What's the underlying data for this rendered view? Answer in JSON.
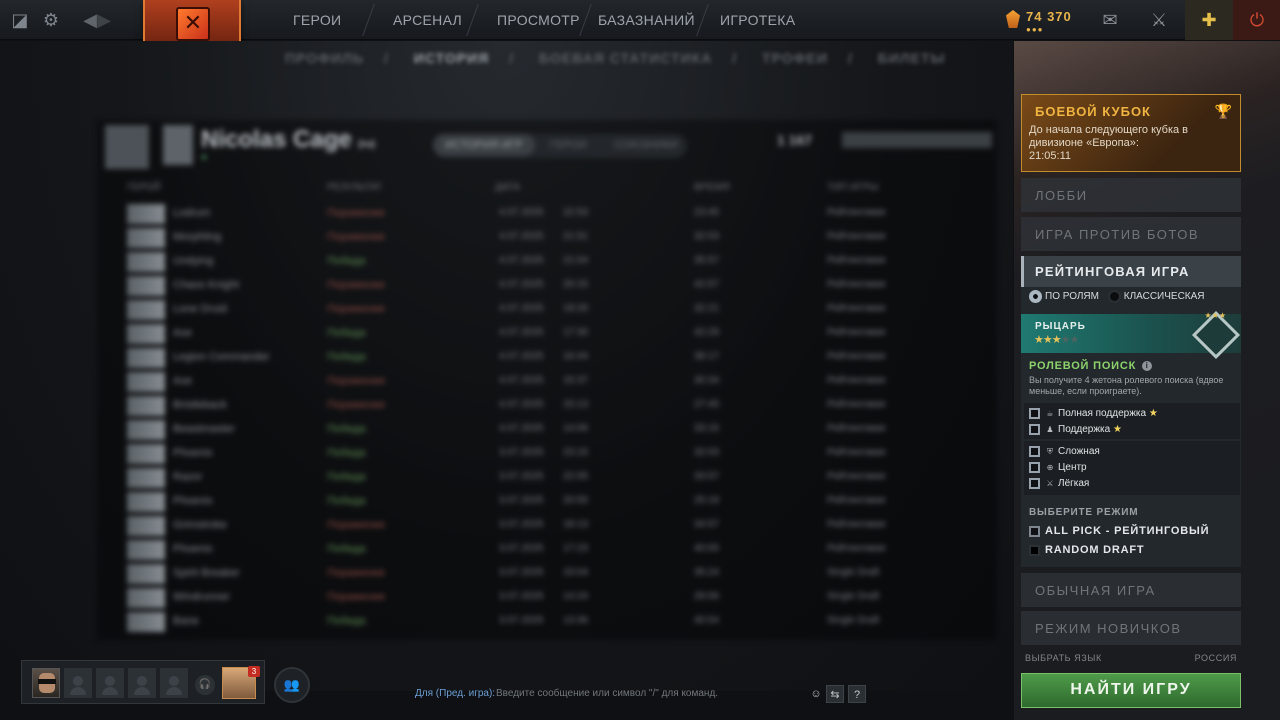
{
  "topbar": {
    "nav": [
      "ГЕРОИ",
      "АРСЕНАЛ",
      "ПРОСМОТР",
      "БАЗАЗНАНИЙ",
      "ИГРОТЕКА"
    ],
    "currency_amount": "74 370",
    "currency_dots": "●●●"
  },
  "subnav": [
    "ПРОФИЛЬ",
    "ИСТОРИЯ",
    "БОЕВАЯ СТАТИСТИКА",
    "ТРОФЕИ",
    "БИЛЕТЫ"
  ],
  "profile": {
    "name": "Nicolas Cage",
    "name_suffix": "(ru)",
    "tabs": [
      "ИСТОРИЯ ИГР",
      "ГЕРОИ",
      "СОЮЗНИКИ"
    ],
    "stat_value": "1 167",
    "columns": [
      "ГЕРОЙ",
      "РЕЗУЛЬТАТ",
      "ДАТА",
      "ВРЕМЯ",
      "ТИП ИГРЫ"
    ],
    "matches": [
      {
        "hero": "Lodrum",
        "result": "Поражение",
        "win": false,
        "date": "4.07.2025",
        "time": "22:53",
        "dur": "23:45",
        "mode": "Рейтинговая"
      },
      {
        "hero": "Morphling",
        "result": "Поражение",
        "win": false,
        "date": "4.07.2025",
        "time": "21:51",
        "dur": "32:03",
        "mode": "Рейтинговая"
      },
      {
        "hero": "Undying",
        "result": "Победа",
        "win": true,
        "date": "4.07.2025",
        "time": "21:04",
        "dur": "35:57",
        "mode": "Рейтинговая"
      },
      {
        "hero": "Chaos Knight",
        "result": "Поражение",
        "win": false,
        "date": "4.07.2025",
        "time": "20:15",
        "dur": "42:57",
        "mode": "Рейтинговая"
      },
      {
        "hero": "Lone Druid",
        "result": "Поражение",
        "win": false,
        "date": "4.07.2025",
        "time": "19:26",
        "dur": "32:21",
        "mode": "Рейтинговая"
      },
      {
        "hero": "Axe",
        "result": "Победа",
        "win": true,
        "date": "4.07.2025",
        "time": "17:30",
        "dur": "42:29",
        "mode": "Рейтинговая"
      },
      {
        "hero": "Legion Commander",
        "result": "Победа",
        "win": true,
        "date": "4.07.2025",
        "time": "16:44",
        "dur": "38:17",
        "mode": "Рейтинговая"
      },
      {
        "hero": "Axe",
        "result": "Поражение",
        "win": false,
        "date": "4.07.2025",
        "time": "15:37",
        "dur": "30:34",
        "mode": "Рейтинговая"
      },
      {
        "hero": "Bristleback",
        "result": "Поражение",
        "win": false,
        "date": "4.07.2025",
        "time": "15:13",
        "dur": "27:45",
        "mode": "Рейтинговая"
      },
      {
        "hero": "Beastmaster",
        "result": "Победа",
        "win": true,
        "date": "4.07.2025",
        "time": "14:06",
        "dur": "33:16",
        "mode": "Рейтинговая"
      },
      {
        "hero": "Phoenix",
        "result": "Победа",
        "win": true,
        "date": "3.07.2025",
        "time": "23:15",
        "dur": "32:03",
        "mode": "Рейтинговая"
      },
      {
        "hero": "Razor",
        "result": "Победа",
        "win": true,
        "date": "3.07.2025",
        "time": "22:05",
        "dur": "33:57",
        "mode": "Рейтинговая"
      },
      {
        "hero": "Phoenix",
        "result": "Победа",
        "win": true,
        "date": "3.07.2025",
        "time": "20:55",
        "dur": "25:19",
        "mode": "Рейтинговая"
      },
      {
        "hero": "Grimstroke",
        "result": "Поражение",
        "win": false,
        "date": "3.07.2025",
        "time": "18:13",
        "dur": "34:57",
        "mode": "Рейтинговая"
      },
      {
        "hero": "Phoenix",
        "result": "Победа",
        "win": true,
        "date": "3.07.2025",
        "time": "17:23",
        "dur": "40:00",
        "mode": "Рейтинговая"
      },
      {
        "hero": "Spirit Breaker",
        "result": "Поражение",
        "win": false,
        "date": "3.07.2025",
        "time": "15:04",
        "dur": "35:24",
        "mode": "Single Draft"
      },
      {
        "hero": "Windrunner",
        "result": "Поражение",
        "win": false,
        "date": "3.07.2025",
        "time": "14:24",
        "dur": "29:56",
        "mode": "Single Draft"
      },
      {
        "hero": "Bane",
        "result": "Победа",
        "win": true,
        "date": "3.07.2025",
        "time": "13:36",
        "dur": "40:54",
        "mode": "Single Draft"
      }
    ]
  },
  "cup": {
    "title": "БОЕВОЙ КУБОК",
    "text": "До начала следующего кубка в дивизионе «Европа»:",
    "timer": "21:05:11"
  },
  "sidebar": {
    "lobby": "ЛОББИ",
    "bots": "ИГРА ПРОТИВ БОТОВ",
    "ranked": "РЕЙТИНГОВАЯ ИГРА",
    "radio_roles": "ПО РОЛЯМ",
    "radio_classic": "КЛАССИЧЕСКАЯ",
    "rank_name": "РЫЦАРЬ",
    "role_search_title": "РОЛЕВОЙ ПОИСК",
    "role_search_desc": "Вы получите 4 жетона ролевого поиска (вдвое меньше, если проиграете).",
    "roles_top": [
      {
        "label": "Полная поддержка",
        "star": "★"
      },
      {
        "label": "Поддержка",
        "star": "★"
      }
    ],
    "roles_bottom": [
      "Сложная",
      "Центр",
      "Лёгкая"
    ],
    "mode_title": "ВЫБЕРИТЕ РЕЖИМ",
    "mode_allpick": "ALL PICK - РЕЙТИНГОВЫЙ",
    "mode_random": "RANDOM DRAFT",
    "normal": "ОБЫЧНАЯ ИГРА",
    "newbie": "РЕЖИМ НОВИЧКОВ",
    "lang_label": "ВЫБРАТЬ ЯЗЫК",
    "lang_value": "РОССИЯ",
    "find": "НАЙТИ ИГРУ"
  },
  "bottom": {
    "friend_badge": "3",
    "chat_channel": "Для (Пред. игра):",
    "chat_placeholder": "Введите сообщение или символ \"/\" для команд.",
    "help": "?"
  }
}
